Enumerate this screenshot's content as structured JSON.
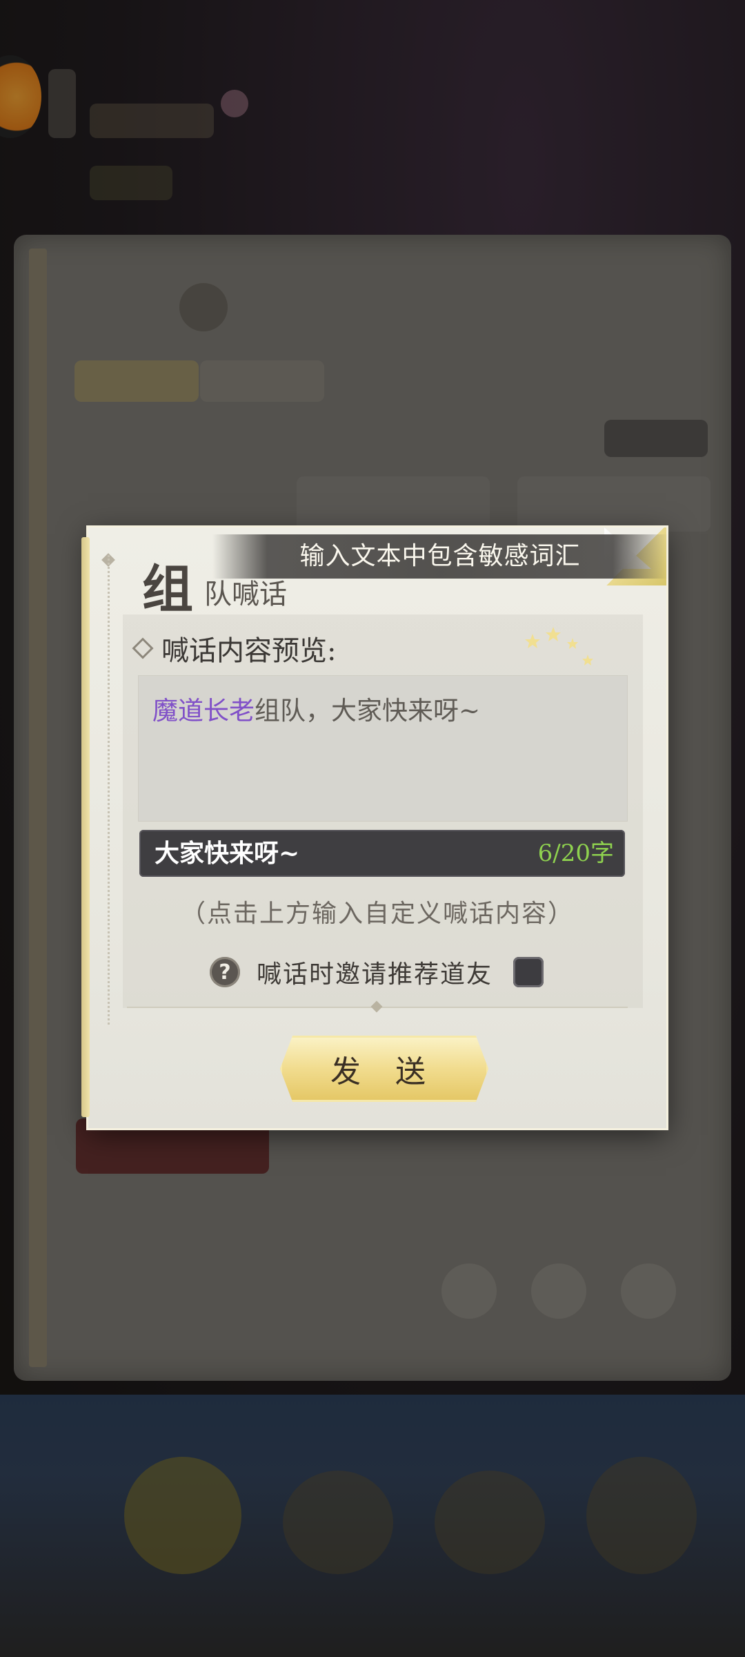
{
  "toast": {
    "message": "输入文本中包含敏感词汇"
  },
  "dialog": {
    "title_main": "组",
    "title_sub": "队喊话",
    "preview_label": "喊话内容预览:",
    "preview": {
      "highlight": "魔道长老",
      "rest": "组队，大家快来呀~"
    },
    "input": {
      "value": "大家快来呀~",
      "counter": "6/20字"
    },
    "hint": "（点击上方输入自定义喊话内容）",
    "invite_label": "喊话时邀请推荐道友",
    "send_label": "发 送"
  },
  "colors": {
    "highlight_name": "#8050c8",
    "counter": "#8fd24f",
    "input_bg": "#3f3e41",
    "button_gold": "#f1dc8e"
  }
}
